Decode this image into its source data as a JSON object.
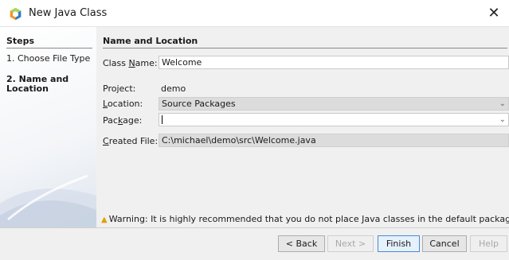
{
  "window": {
    "title": "New Java Class",
    "close_glyph": "✕"
  },
  "steps": {
    "heading": "Steps",
    "items": [
      {
        "label": "1. Choose File Type"
      },
      {
        "label": "2. Name and Location"
      }
    ]
  },
  "main": {
    "section_title": "Name and Location",
    "class_name": {
      "label_pre": "Class ",
      "label_key": "N",
      "label_post": "ame:",
      "value": "Welcome"
    },
    "project": {
      "label": "Project:",
      "value": "demo"
    },
    "location": {
      "label_pre": "",
      "label_key": "L",
      "label_post": "ocation:",
      "value": "Source Packages"
    },
    "package": {
      "label_pre": "Pac",
      "label_key": "k",
      "label_post": "age:",
      "value": ""
    },
    "created_file": {
      "label_pre": "",
      "label_key": "C",
      "label_post": "reated File:",
      "value": "C:\\michael\\demo\\src\\Welcome.java"
    },
    "warning": "Warning: It is highly recommended that you do not place Java classes in the default package"
  },
  "footer": {
    "back": "< Back",
    "back_key": "B",
    "next": "Next >",
    "finish": "Finish",
    "finish_key": "F",
    "cancel": "Cancel",
    "help": "Help",
    "help_key": "H"
  },
  "icons": {
    "app": "netbeans-cube-icon",
    "dropdown": "chevron-down-icon",
    "warning": "warning-triangle-icon"
  },
  "colors": {
    "accent_primary_button": "#4a8ad6",
    "panel_bg": "#f0f0f0",
    "selected_field_bg": "#dcdcdc",
    "warning_icon": "#e0a000"
  }
}
